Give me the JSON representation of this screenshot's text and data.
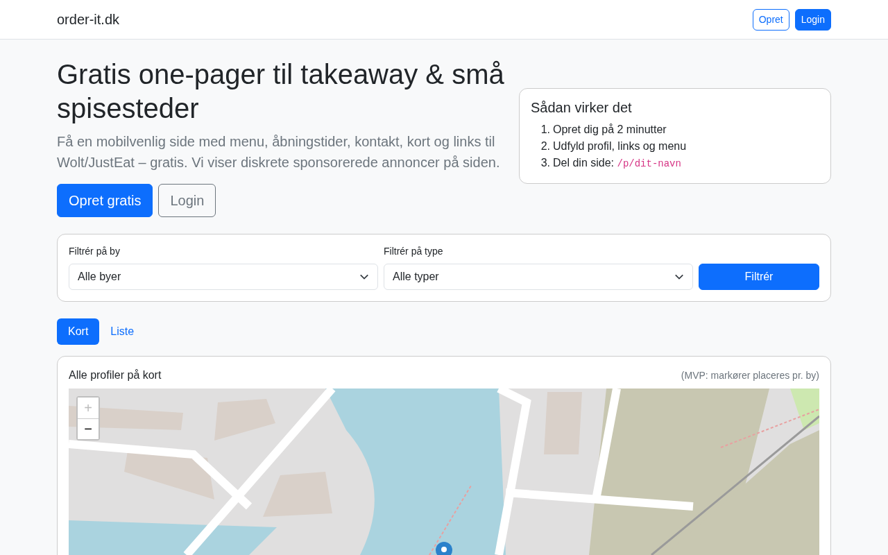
{
  "navbar": {
    "brand": "order-it.dk",
    "buttons": [
      {
        "label": "Opret",
        "kind": "outline"
      },
      {
        "label": "Login",
        "kind": "primary"
      }
    ]
  },
  "hero": {
    "title": "Gratis one-pager til takeaway & små spisesteder",
    "lead": "Få en mobilvenlig side med menu, åbningstider, kontakt, kort og links til Wolt/JustEat – gratis. Vi viser diskrete sponsorerede annoncer på siden.",
    "buttons": [
      {
        "label": "Opret gratis",
        "kind": "primary"
      },
      {
        "label": "Login",
        "kind": "outline"
      }
    ]
  },
  "how_it_works": {
    "title": "Sådan virker det",
    "steps": [
      {
        "marker": "1.",
        "text": "Opret dig på 2 minutter"
      },
      {
        "marker": "2.",
        "text": "Udfyld profil, links og menu"
      },
      {
        "marker": "3.",
        "text": "Del din side: ",
        "code": "/p/dit-navn"
      }
    ]
  },
  "filter": {
    "fields": [
      {
        "label": "Filtrér på by",
        "value": "Alle byer"
      },
      {
        "label": "Filtrér på type",
        "value": "Alle typer"
      }
    ],
    "button": "Filtrér"
  },
  "tabs": [
    {
      "label": "Kort",
      "selected": true
    },
    {
      "label": "Liste",
      "selected": false
    }
  ],
  "map_card": {
    "title": "Alle profiler på kort",
    "note": "(MVP: markører placeres pr. by)",
    "zoom": [
      {
        "label": "+",
        "disabled": true
      },
      {
        "label": "−",
        "disabled": false
      }
    ]
  }
}
